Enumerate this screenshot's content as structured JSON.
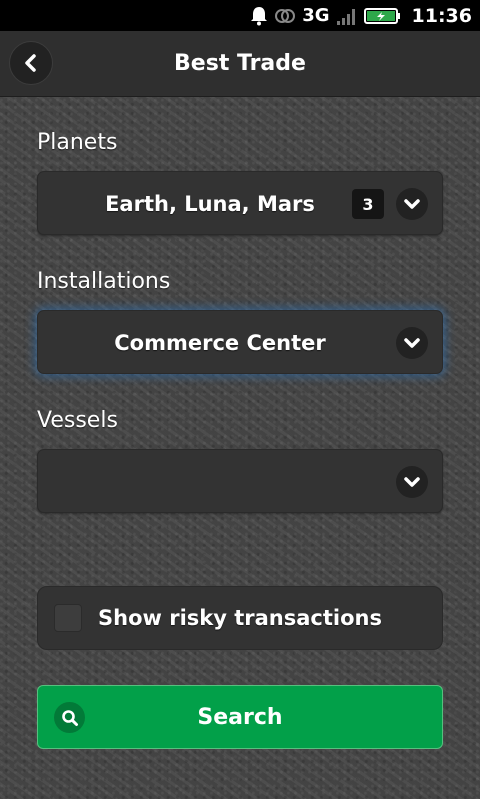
{
  "status_bar": {
    "network": "3G",
    "time": "11:36",
    "icons": [
      "bell-icon",
      "sync-icon",
      "signal-icon",
      "battery-charging-icon"
    ]
  },
  "header": {
    "title": "Best Trade",
    "back_icon": "chevron-left-icon"
  },
  "form": {
    "planets": {
      "label": "Planets",
      "value": "Earth, Luna, Mars",
      "count": "3"
    },
    "installations": {
      "label": "Installations",
      "value": "Commerce Center"
    },
    "vessels": {
      "label": "Vessels",
      "value": ""
    },
    "risky": {
      "label": "Show risky transactions",
      "checked": false
    },
    "search": {
      "label": "Search",
      "icon": "search-icon"
    }
  },
  "colors": {
    "accent": "#02a049",
    "focus_glow": "#2878c8",
    "surface": "#333333"
  }
}
